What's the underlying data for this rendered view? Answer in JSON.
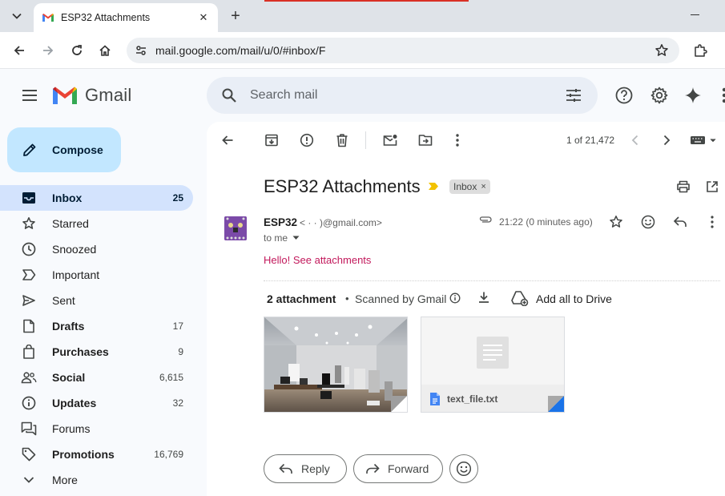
{
  "browser": {
    "tab_title": "ESP32 Attachments",
    "tab_close": "✕",
    "new_tab": "+",
    "url": "mail.google.com/mail/u/0/#inbox/F"
  },
  "header": {
    "logo_text": "Gmail",
    "search_placeholder": "Search mail"
  },
  "sidebar": {
    "compose_label": "Compose",
    "items": [
      {
        "label": "Inbox",
        "count": "25",
        "icon": "inbox-icon",
        "active": true,
        "bold": true
      },
      {
        "label": "Starred",
        "count": "",
        "icon": "star-icon",
        "active": false,
        "bold": false
      },
      {
        "label": "Snoozed",
        "count": "",
        "icon": "clock-icon",
        "active": false,
        "bold": false
      },
      {
        "label": "Important",
        "count": "",
        "icon": "important-icon",
        "active": false,
        "bold": false
      },
      {
        "label": "Sent",
        "count": "",
        "icon": "send-icon",
        "active": false,
        "bold": false
      },
      {
        "label": "Drafts",
        "count": "17",
        "icon": "draft-icon",
        "active": false,
        "bold": true
      },
      {
        "label": "Purchases",
        "count": "9",
        "icon": "bag-icon",
        "active": false,
        "bold": true
      },
      {
        "label": "Social",
        "count": "6,615",
        "icon": "people-icon",
        "active": false,
        "bold": true
      },
      {
        "label": "Updates",
        "count": "32",
        "icon": "info-icon",
        "active": false,
        "bold": true
      },
      {
        "label": "Forums",
        "count": "",
        "icon": "forum-icon",
        "active": false,
        "bold": false
      },
      {
        "label": "Promotions",
        "count": "16,769",
        "icon": "tag-icon",
        "active": false,
        "bold": true
      },
      {
        "label": "More",
        "count": "",
        "icon": "chevron-down-icon",
        "active": false,
        "bold": false
      }
    ]
  },
  "toolbar": {
    "pager": "1 of 21,472"
  },
  "email": {
    "subject": "ESP32 Attachments",
    "label": "Inbox",
    "label_remove": "×",
    "sender_name": "ESP32",
    "sender_email": "<  ·    ·    )@gmail.com>",
    "to": "to me",
    "time": "21:22 (0 minutes ago)",
    "body": "Hello! See attachments",
    "attachments_count": "2 attachment",
    "dot": "•",
    "scanned": "Scanned by Gmail",
    "add_to_drive": "Add all to Drive",
    "file_name": "text_file.txt"
  },
  "actions": {
    "reply": "Reply",
    "forward": "Forward"
  },
  "colors": {
    "accent": "#0b57d0",
    "compose_bg": "#c2e7ff",
    "active_nav_bg": "#d3e3fd",
    "body_text": "#c2185b",
    "avatar": "#8e5bb8"
  }
}
